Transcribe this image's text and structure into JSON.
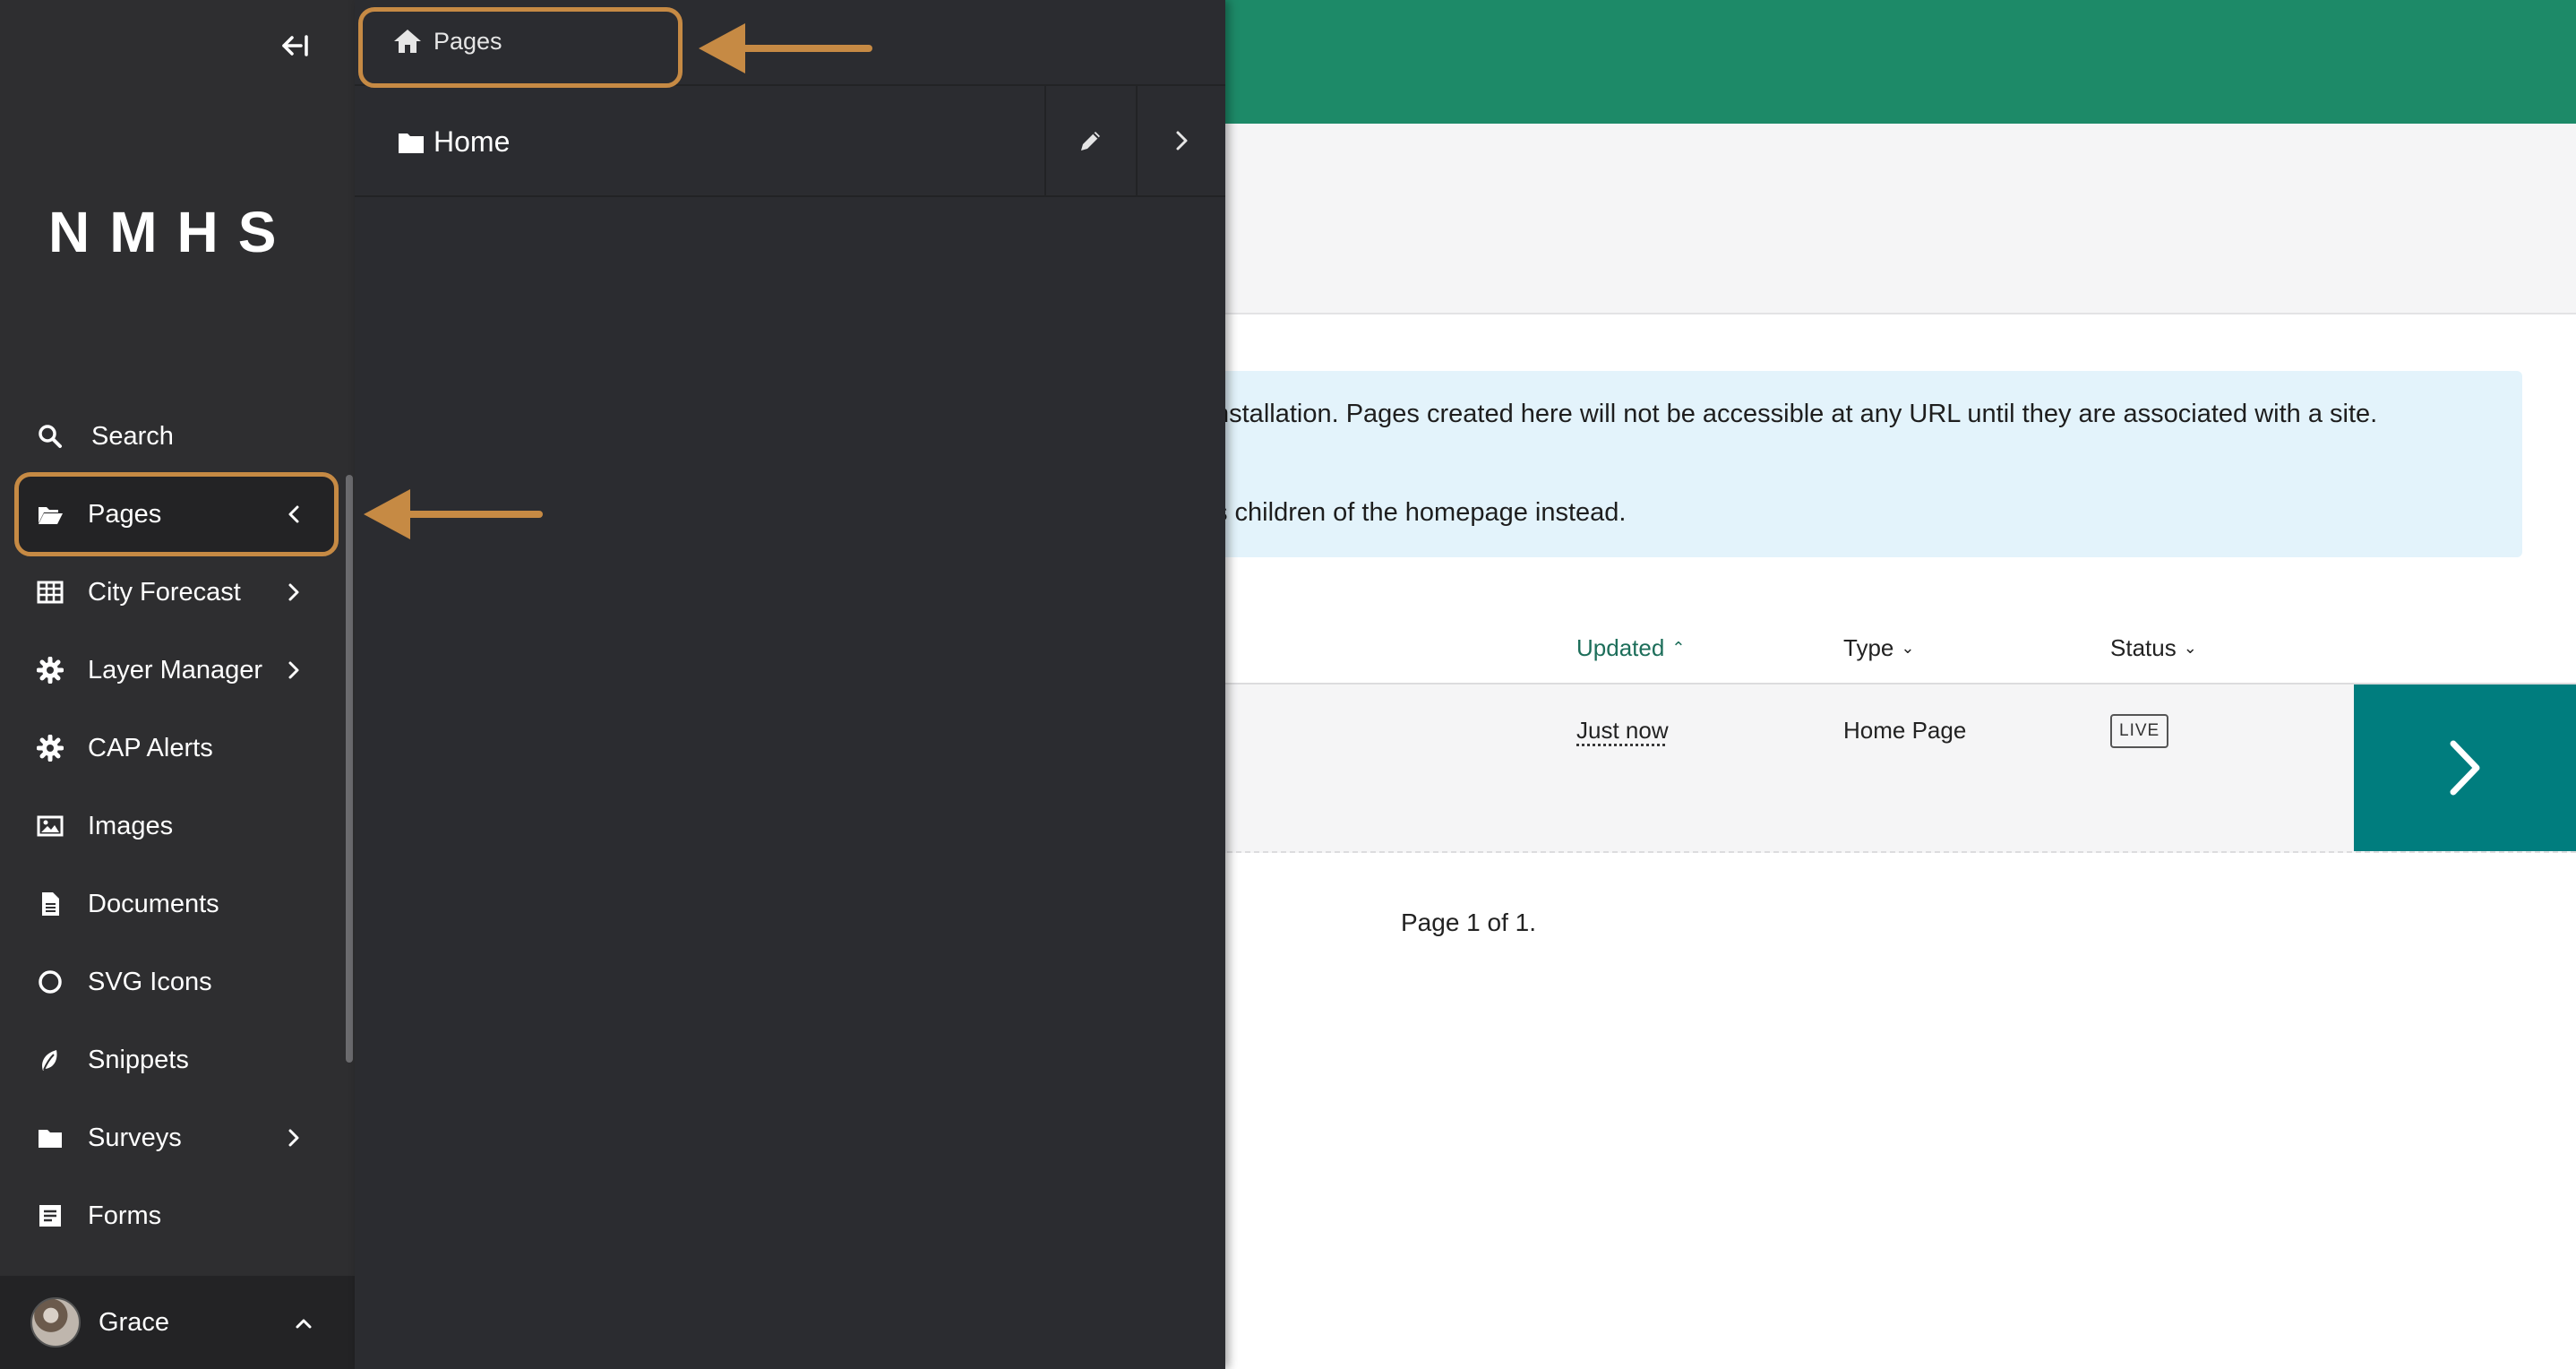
{
  "main": {
    "help_text_line1": "nstallation. Pages created here will not be accessible at any URL until they are associated with a site.",
    "help_text_line2": "s children of the homepage instead.",
    "columns": {
      "updated": "Updated",
      "type": "Type",
      "status": "Status"
    },
    "rows": [
      {
        "updated": "Just now",
        "type": "Home Page",
        "status": "LIVE"
      }
    ],
    "pagination": "Page 1 of 1.",
    "colors": {
      "topbar": "#1d8a68",
      "row_action": "#007d7e",
      "help_bg": "#e3f3fb"
    }
  },
  "sidebar": {
    "logo": "NMHS",
    "collapse_icon": "collapse-left-icon",
    "items": [
      {
        "label": "Search",
        "icon": "search-icon",
        "has_chevron": false
      },
      {
        "label": "Pages",
        "icon": "folder-open-icon",
        "has_chevron": true,
        "active": true
      },
      {
        "label": "City Forecast",
        "icon": "table-icon",
        "has_chevron": true
      },
      {
        "label": "Layer Manager",
        "icon": "gear-icon",
        "has_chevron": true
      },
      {
        "label": "CAP Alerts",
        "icon": "gear-icon",
        "has_chevron": false
      },
      {
        "label": "Images",
        "icon": "image-icon",
        "has_chevron": false
      },
      {
        "label": "Documents",
        "icon": "document-icon",
        "has_chevron": false
      },
      {
        "label": "SVG Icons",
        "icon": "circle-icon",
        "has_chevron": false
      },
      {
        "label": "Snippets",
        "icon": "leaf-icon",
        "has_chevron": false
      },
      {
        "label": "Surveys",
        "icon": "folder-icon",
        "has_chevron": true
      },
      {
        "label": "Forms",
        "icon": "form-icon",
        "has_chevron": false
      }
    ],
    "account": {
      "name": "Grace"
    }
  },
  "explorer": {
    "breadcrumb": "Pages",
    "items": [
      {
        "title": "Home"
      }
    ]
  },
  "annotations": {
    "highlight_color": "#c68a44"
  }
}
